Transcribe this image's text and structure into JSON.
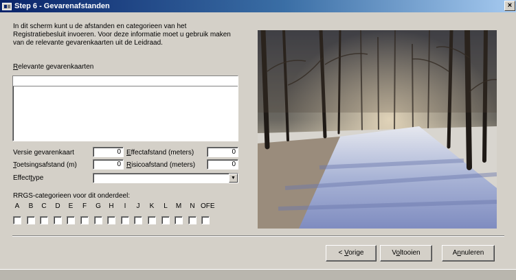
{
  "window": {
    "title": "Step 6 - Gevarenafstanden",
    "close_glyph": "×"
  },
  "intro_text": "In dit scherm kunt u de afstanden en categorieen van het Registratiebesluit invoeren. Voor deze informatie moet u gebruik maken van de relevante gevarenkaarten uit de Leidraad.",
  "gevarenkaarten": {
    "label_accel": "R",
    "label_rest": "elevante gevarenkaarten"
  },
  "fields": {
    "versie_label": "Versie gevarenkaart",
    "versie_value": "0",
    "effectafstand_accel": "E",
    "effectafstand_rest": "ffectafstand (meters)",
    "effectafstand_value": "0",
    "toetsing_accel": "T",
    "toetsing_rest": "oetsingsafstand (m)",
    "toetsing_value": "0",
    "risico_accel": "R",
    "risico_rest": "isicoafstand (meters)",
    "risico_value": "0",
    "effecttype_pre": "Effect",
    "effecttype_accel": "t",
    "effecttype_post": "ype",
    "effecttype_value": ""
  },
  "categories": {
    "label": "RRGS-categorieen voor dit onderdeel:",
    "letters": [
      "A",
      "B",
      "C",
      "D",
      "E",
      "F",
      "G",
      "H",
      "I",
      "J",
      "K",
      "L",
      "M",
      "N",
      "OFE"
    ],
    "checked": [
      false,
      false,
      false,
      false,
      false,
      false,
      false,
      false,
      false,
      false,
      false,
      false,
      false,
      false,
      false
    ]
  },
  "photo": {
    "subject": "snowy forest path"
  },
  "buttons": {
    "vorige_pre": "< ",
    "vorige_accel": "V",
    "vorige_post": "orige",
    "voltooien_pre": "V",
    "voltooien_accel": "o",
    "voltooien_post": "ltooien",
    "annuleren_pre": "A",
    "annuleren_accel": "n",
    "annuleren_post": "nuleren"
  },
  "colors": {
    "titlebar_start": "#0a246a",
    "titlebar_end": "#a6caf0",
    "face": "#d4d0c8"
  }
}
